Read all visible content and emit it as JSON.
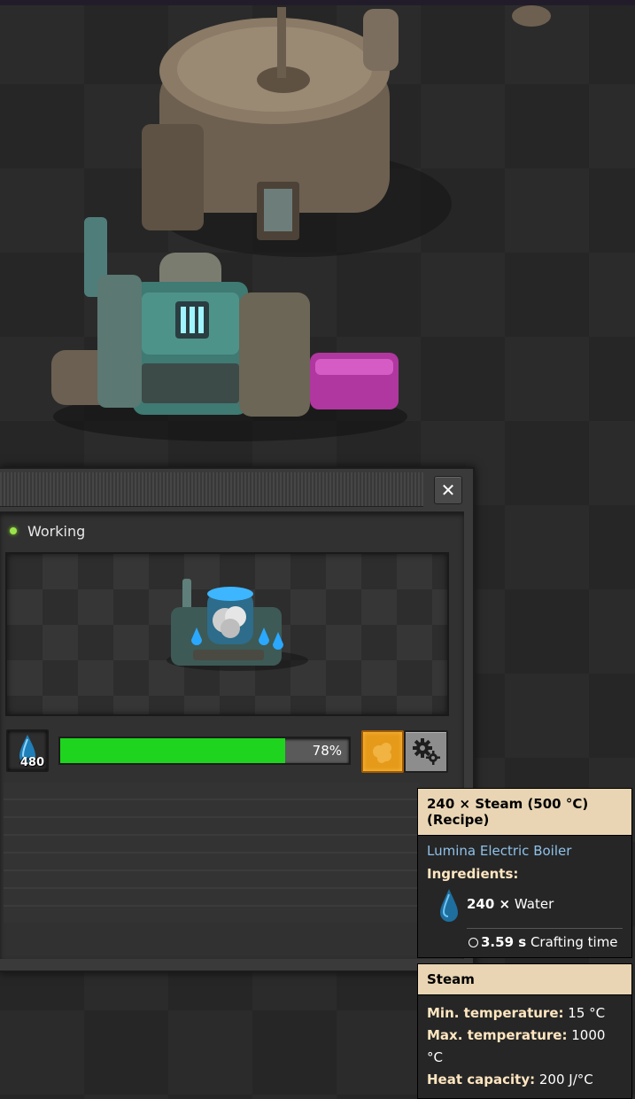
{
  "status": {
    "text": "Working",
    "color": "#9be34b"
  },
  "input_slot": {
    "item_icon": "water-drop-icon",
    "count": "480"
  },
  "progress": {
    "value": 0.78,
    "label": "78%"
  },
  "buttons": {
    "close": "✕",
    "recipe_icon": "steam-recipe-icon",
    "settings_icon": "gear-icon"
  },
  "tooltip": {
    "recipe_header": "240 × Steam (500 °C) (Recipe)",
    "machine": "Lumina Electric Boiler",
    "ingredients_label": "Ingredients:",
    "ingredient": {
      "amount": "240 ×",
      "name": "Water",
      "icon": "water-drop-icon"
    },
    "crafting_time": {
      "value": "3.59 s",
      "label": "Crafting time"
    },
    "product_header": "Steam",
    "stats": [
      {
        "label": "Min. temperature:",
        "value": "15 °C"
      },
      {
        "label": "Max. temperature:",
        "value": "1000 °C"
      },
      {
        "label": "Heat capacity:",
        "value": "200 J/°C"
      }
    ]
  }
}
